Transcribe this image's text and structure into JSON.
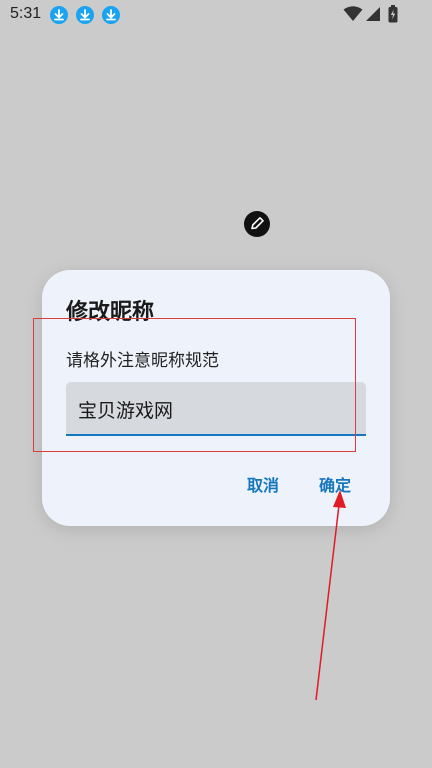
{
  "status_bar": {
    "time": "5:31",
    "icons": [
      "download-icon",
      "download-icon",
      "download-icon",
      "wifi-icon",
      "signal-icon",
      "battery-charging-icon"
    ]
  },
  "dialog": {
    "title": "修改昵称",
    "message": "请格外注意昵称规范",
    "input_value": "宝贝游戏网",
    "cancel_label": "取消",
    "confirm_label": "确定"
  },
  "colors": {
    "background": "#cbcbcb",
    "dialog_bg": "#eef2fb",
    "accent": "#1577c0",
    "annotation": "#e01b24"
  }
}
